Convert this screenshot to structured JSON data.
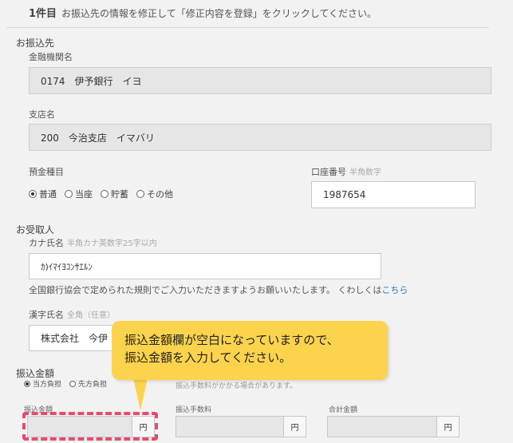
{
  "header": {
    "number": "1件目",
    "instruction": "お振込先の情報を修正して「修正内容を登録」をクリックしてください。"
  },
  "payee": {
    "section_title": "お振込先",
    "bank_label": "金融機関名",
    "bank_value": "0174　伊予銀行　イヨ",
    "branch_label": "支店名",
    "branch_value": "200　今治支店　イマバリ",
    "account_type_label": "預金種目",
    "account_types": [
      "普通",
      "当座",
      "貯蓄",
      "その他"
    ],
    "account_type_selected": "普通",
    "account_no_label": "口座番号",
    "account_no_hint": "半角数字",
    "account_no_value": "1987654"
  },
  "recipient": {
    "section_title": "お受取人",
    "kana_label": "カナ氏名",
    "kana_hint": "半角カナ英数字25字以内",
    "kana_value": "ｶ)ｲﾏｲﾖｺﾝｻｴﾙﾝ",
    "note_text": "全国銀行協会で定められた規則でご入力いただきますようお願いいたします。 くわしくは",
    "note_link": "こちら",
    "kanji_label": "漢字氏名",
    "kanji_hint": "全角（任意）",
    "kanji_value": "株式会社　今伊"
  },
  "amount": {
    "section_title": "振込金額",
    "options": [
      "当方負担",
      "先方負担"
    ],
    "option_selected": "当方負担",
    "side_note": "振込手数料がかかる場合があります。",
    "transfer_label": "振込金額",
    "fee_label": "振込手数料",
    "total_label": "合計金額",
    "unit": "円"
  },
  "callout": {
    "line1": "振込金額欄が空白になっていますので、",
    "line2": "振込金額を入力してください。",
    "color": "#fcd34d"
  },
  "highlight_color": "#e84a6e"
}
